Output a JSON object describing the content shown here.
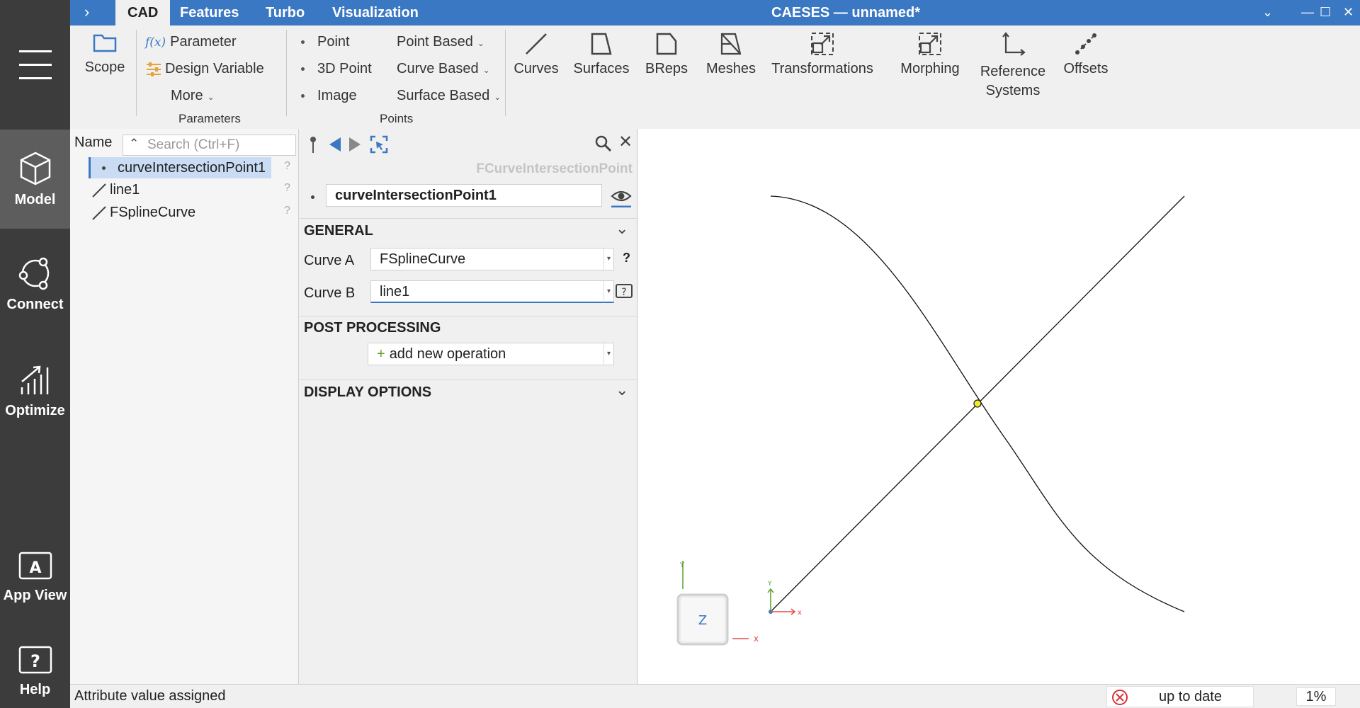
{
  "app": {
    "title": "CAESES — unnamed*"
  },
  "tabs": [
    "CAD",
    "Features",
    "Turbo",
    "Visualization"
  ],
  "rail": {
    "items": [
      {
        "label": "Model",
        "icon": "cube-icon"
      },
      {
        "label": "Connect",
        "icon": "connect-icon"
      },
      {
        "label": "Optimize",
        "icon": "optimize-icon"
      },
      {
        "label": "App View",
        "icon": "app-view-icon"
      },
      {
        "label": "Help",
        "icon": "help-icon"
      }
    ]
  },
  "ribbon": {
    "scope": "Scope",
    "parameter": "Parameter",
    "design_variable": "Design Variable",
    "more": "More",
    "parameters_group": "Parameters",
    "point": "Point",
    "point_3d": "3D Point",
    "image": "Image",
    "point_based": "Point Based",
    "curve_based": "Curve Based",
    "surface_based": "Surface Based",
    "points_group": "Points",
    "curves": "Curves",
    "surfaces": "Surfaces",
    "breps": "BReps",
    "meshes": "Meshes",
    "transformations": "Transformations",
    "morphing": "Morphing",
    "reference_systems_1": "Reference",
    "reference_systems_2": "Systems",
    "offsets": "Offsets"
  },
  "tree": {
    "header": "Name",
    "search_placeholder": "Search (Ctrl+F)",
    "items": [
      "curveIntersectionPoint1",
      "line1",
      "FSplineCurve"
    ],
    "help_mark": "?"
  },
  "props": {
    "type_label": "FCurveIntersectionPoint",
    "object_name": "curveIntersectionPoint1",
    "general": "GENERAL",
    "curve_a_label": "Curve A",
    "curve_a_value": "FSplineCurve",
    "curve_b_label": "Curve B",
    "curve_b_value": "line1",
    "help_mark": "?",
    "post_processing": "POST PROCESSING",
    "add_operation": "add new operation",
    "display_options": "DISPLAY OPTIONS"
  },
  "viewport": {
    "cube_face": "Z",
    "axis_x": "x",
    "axis_y": "Y",
    "small_axis_x": "x",
    "small_axis_y": "Y"
  },
  "status": {
    "message": "Attribute value assigned",
    "state": "up to date",
    "percent": "1%"
  },
  "colors": {
    "accent": "#3b78c3",
    "rail": "#3c3c3c",
    "rail_active": "#5d5d5d"
  }
}
